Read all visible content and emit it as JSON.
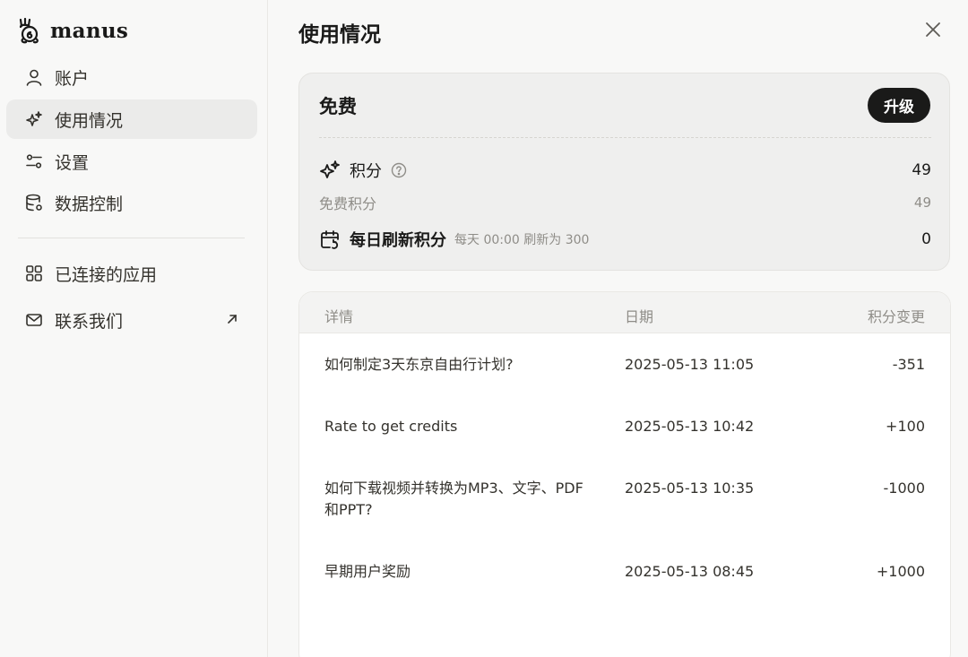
{
  "brand": {
    "name": "manus"
  },
  "sidebar": {
    "items": [
      {
        "label": "账户",
        "icon": "user-icon"
      },
      {
        "label": "使用情况",
        "icon": "sparkle-icon",
        "active": true
      },
      {
        "label": "设置",
        "icon": "sliders-icon"
      },
      {
        "label": "数据控制",
        "icon": "database-icon"
      },
      {
        "label": "已连接的应用",
        "icon": "apps-grid-icon"
      },
      {
        "label": "联系我们",
        "icon": "mail-icon",
        "external": true
      }
    ]
  },
  "main": {
    "title": "使用情况",
    "plan": {
      "name": "免费",
      "upgrade_label": "升级",
      "credits_label": "积分",
      "credits_value": "49",
      "free_credits_label": "免费积分",
      "free_credits_value": "49",
      "daily_label": "每日刷新积分",
      "daily_note": "每天 00:00 刷新为 300",
      "daily_value": "0"
    },
    "table": {
      "headers": {
        "detail": "详情",
        "date": "日期",
        "change": "积分变更"
      },
      "rows": [
        {
          "detail": "如何制定3天东京自由行计划?",
          "date": "2025-05-13 11:05",
          "change": "-351"
        },
        {
          "detail": "Rate to get credits",
          "date": "2025-05-13 10:42",
          "change": "+100"
        },
        {
          "detail": "如何下载视频并转换为MP3、文字、PDF和PPT?",
          "date": "2025-05-13 10:35",
          "change": "-1000"
        },
        {
          "detail": "早期用户奖励",
          "date": "2025-05-13 08:45",
          "change": "+1000"
        }
      ]
    }
  },
  "colors": {
    "accent_dark": "#1a1a19",
    "muted_text": "#8f8d88",
    "active_bg": "#ebebea"
  }
}
